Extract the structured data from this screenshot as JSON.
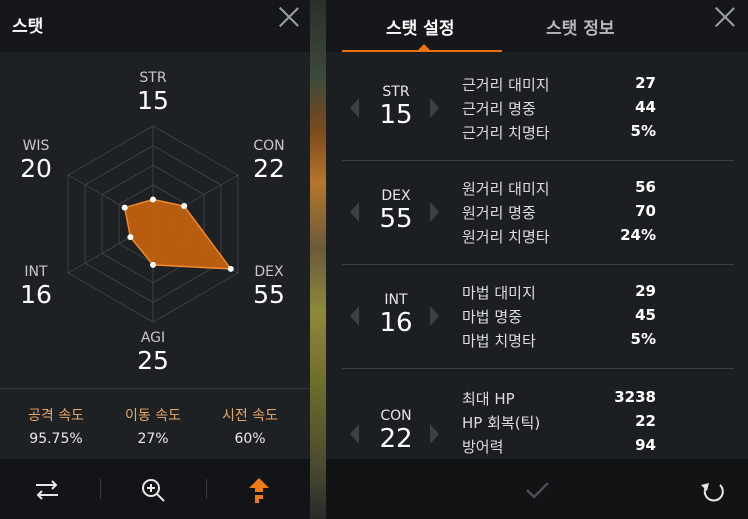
{
  "left": {
    "title": "스탯",
    "radar": {
      "str": {
        "label": "STR",
        "value": "15"
      },
      "con": {
        "label": "CON",
        "value": "22"
      },
      "dex": {
        "label": "DEX",
        "value": "55"
      },
      "agi": {
        "label": "AGI",
        "value": "25"
      },
      "int": {
        "label": "INT",
        "value": "16"
      },
      "wis": {
        "label": "WIS",
        "value": "20"
      }
    },
    "speeds": [
      {
        "label": "공격 속도",
        "value": "95.75%",
        "color": "#e8a86a"
      },
      {
        "label": "이동 속도",
        "value": "27%",
        "color": "#e8a86a"
      },
      {
        "label": "시전 속도",
        "value": "60%",
        "color": "#e8a86a"
      }
    ],
    "footer_icons": [
      "swap-icon",
      "zoom-in-icon",
      "level-up-icon"
    ],
    "accent": "#e8730f"
  },
  "right": {
    "tabs": [
      "스탯 설정",
      "스탯 정보"
    ],
    "active_tab": 0,
    "blocks": [
      {
        "name": "STR",
        "value": "15",
        "rows": [
          {
            "label": "근거리 대미지",
            "value": "27"
          },
          {
            "label": "근거리 명중",
            "value": "44"
          },
          {
            "label": "근거리 치명타",
            "value": "5%"
          }
        ]
      },
      {
        "name": "DEX",
        "value": "55",
        "rows": [
          {
            "label": "원거리 대미지",
            "value": "56"
          },
          {
            "label": "원거리 명중",
            "value": "70"
          },
          {
            "label": "원거리 치명타",
            "value": "24%"
          }
        ]
      },
      {
        "name": "INT",
        "value": "16",
        "rows": [
          {
            "label": "마법 대미지",
            "value": "29"
          },
          {
            "label": "마법 명중",
            "value": "45"
          },
          {
            "label": "마법 치명타",
            "value": "5%"
          }
        ]
      },
      {
        "name": "CON",
        "value": "22",
        "rows": [
          {
            "label": "최대 HP",
            "value": "3238"
          },
          {
            "label": "HP 회복(틱)",
            "value": "22"
          },
          {
            "label": "방어력",
            "value": "94"
          }
        ]
      }
    ],
    "footer_icons": [
      "confirm-icon",
      "reset-icon"
    ]
  }
}
